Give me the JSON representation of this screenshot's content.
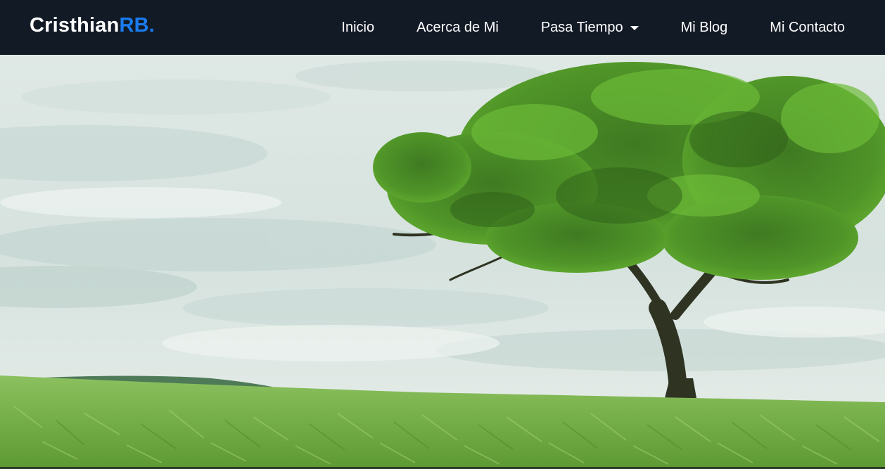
{
  "brand": {
    "name": "Cristhian",
    "accent": "RB.",
    "accent_color": "#1a7cf0"
  },
  "nav": {
    "items": [
      {
        "label": "Inicio"
      },
      {
        "label": "Acerca de Mi"
      },
      {
        "label": "Pasa Tiempo",
        "has_dropdown": true,
        "icon": "caret-down-icon"
      },
      {
        "label": "Mi Blog"
      },
      {
        "label": "Mi Contacto"
      }
    ]
  },
  "hero": {
    "image": "tree-in-green-field"
  },
  "colors": {
    "navbar_bg": "#121a26",
    "nav_text": "#ffffff"
  }
}
